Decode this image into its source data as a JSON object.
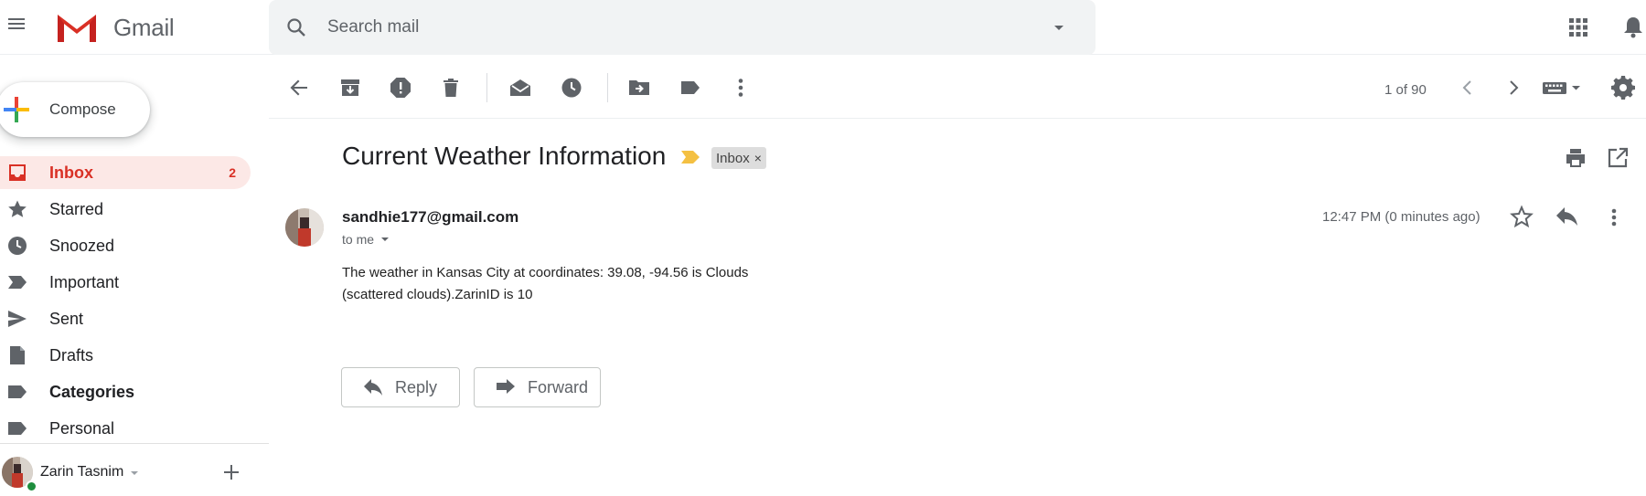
{
  "app": {
    "name": "Gmail"
  },
  "search": {
    "placeholder": "Search mail"
  },
  "sidebar": {
    "compose_label": "Compose",
    "items": [
      {
        "label": "Inbox",
        "count": "2",
        "icon": "inbox-icon"
      },
      {
        "label": "Starred",
        "icon": "star-icon"
      },
      {
        "label": "Snoozed",
        "icon": "clock-icon"
      },
      {
        "label": "Important",
        "icon": "label-important-icon"
      },
      {
        "label": "Sent",
        "icon": "send-icon"
      },
      {
        "label": "Drafts",
        "icon": "draft-icon"
      },
      {
        "label": "Categories",
        "icon": "label-icon"
      },
      {
        "label": "Personal",
        "icon": "label-icon"
      }
    ],
    "user_name": "Zarin Tasnim"
  },
  "toolbar": {
    "pager": "1 of 90"
  },
  "message": {
    "subject": "Current Weather Information",
    "label": "Inbox",
    "label_close": "×",
    "sender": "sandhie177@gmail.com",
    "to": "to me",
    "time": "12:47 PM (0 minutes ago)",
    "body_line1": "The weather in Kansas City at coordinates: 39.08, -94.56 is Clouds",
    "body_line2": "(scattered clouds).ZarinID is 10"
  },
  "actions": {
    "reply": "Reply",
    "forward": "Forward"
  },
  "colors": {
    "accent_red": "#d93025",
    "active_bg": "#fce8e6",
    "importance_yellow": "#f4c042",
    "online_green": "#1e8e3e"
  }
}
